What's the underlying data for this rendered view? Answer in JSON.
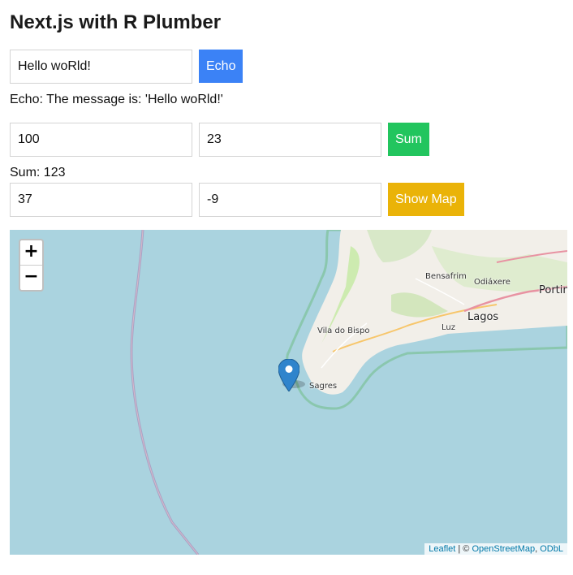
{
  "title": "Next.js with R Plumber",
  "echo": {
    "input_value": "Hello woRld!",
    "button_label": "Echo",
    "result": "Echo: The message is: 'Hello woRld!'"
  },
  "sum": {
    "a_value": "100",
    "b_value": "23",
    "button_label": "Sum",
    "result": "Sum: 123"
  },
  "map_form": {
    "lat_value": "37",
    "lng_value": "-9",
    "button_label": "Show Map"
  },
  "map": {
    "zoom_in": "+",
    "zoom_out": "−",
    "places": {
      "bensafrim": "Bensafrim",
      "odiaxere": "Odiáxere",
      "portimao": "Portim",
      "lagos": "Lagos",
      "vila_do_bispo": "Vila do Bispo",
      "luz": "Luz",
      "sagres": "Sagres"
    },
    "attribution": {
      "leaflet": "Leaflet",
      "separator": " | © ",
      "osm": "OpenStreetMap",
      "comma": ", ",
      "odbl": "ODbL"
    },
    "marker_icon": "map-pin-icon"
  },
  "colors": {
    "echo_button": "#3b82f6",
    "sum_button": "#22c55e",
    "map_button": "#eab308",
    "sea": "#aad3df",
    "land": "#f2efe9"
  }
}
